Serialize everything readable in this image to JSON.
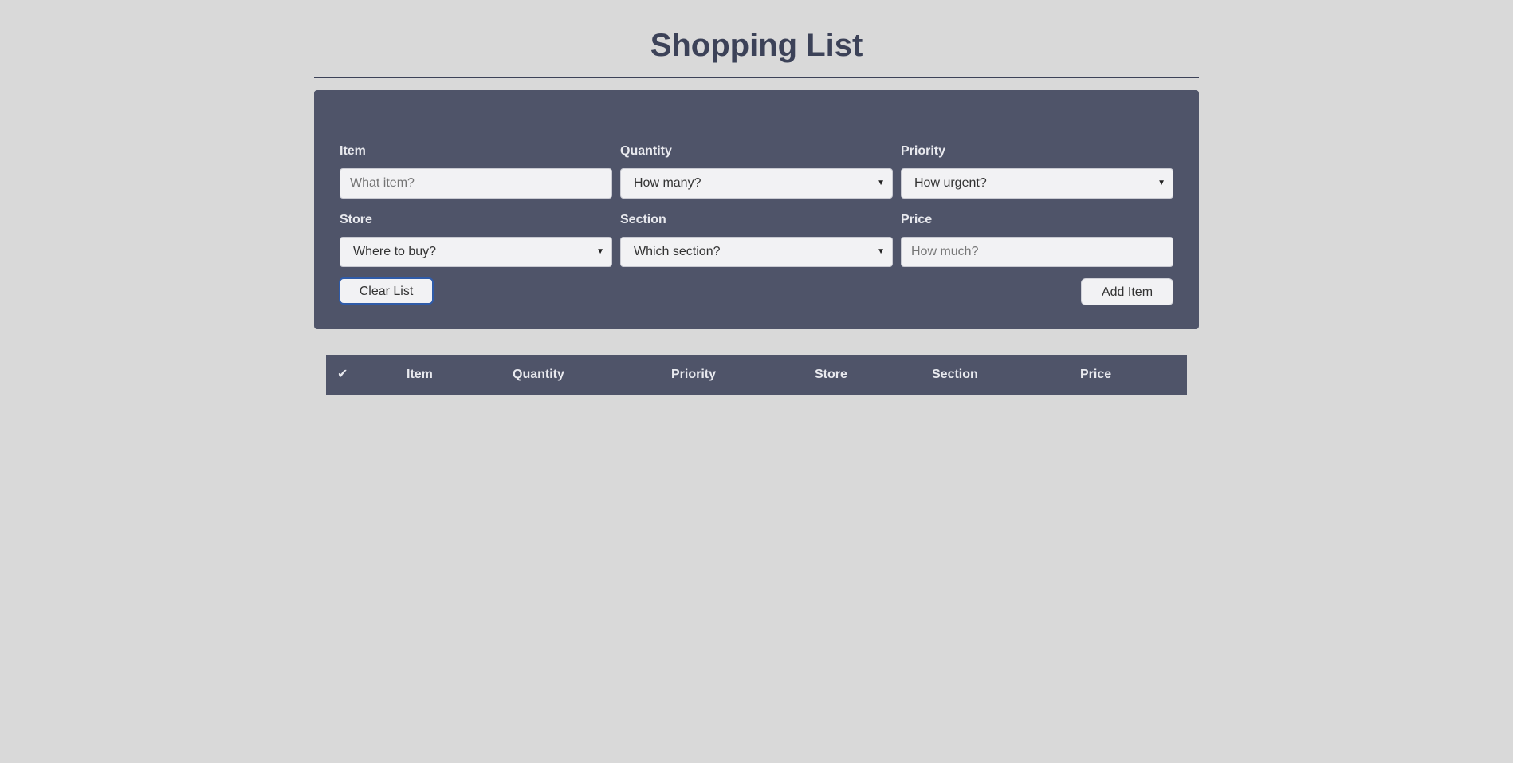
{
  "page": {
    "title": "Shopping List"
  },
  "form": {
    "item": {
      "label": "Item",
      "placeholder": "What item?"
    },
    "quantity": {
      "label": "Quantity",
      "selected": "How many?"
    },
    "priority": {
      "label": "Priority",
      "selected": "How urgent?"
    },
    "store": {
      "label": "Store",
      "selected": "Where to buy?"
    },
    "section": {
      "label": "Section",
      "selected": "Which section?"
    },
    "price": {
      "label": "Price",
      "placeholder": "How much?"
    },
    "clear_button": "Clear List",
    "add_button": "Add Item"
  },
  "table": {
    "headers": {
      "check": "✔",
      "item": "Item",
      "quantity": "Quantity",
      "priority": "Priority",
      "store": "Store",
      "section": "Section",
      "price": "Price"
    },
    "rows": []
  },
  "icons": {
    "dropdown": "caret-down-icon",
    "check": "checkmark-icon"
  },
  "colors": {
    "background": "#d9d9d9",
    "panel": "#4f5469",
    "title": "#3c4258",
    "label": "#e8e9ee",
    "input_bg": "#f2f2f4",
    "focus_border": "#2f5ba8"
  }
}
